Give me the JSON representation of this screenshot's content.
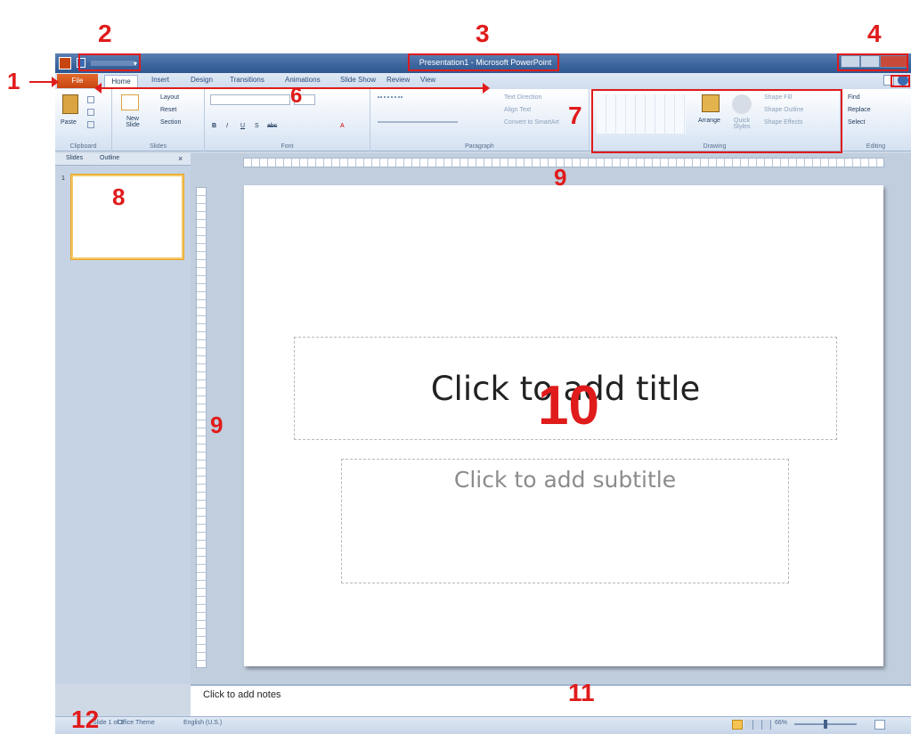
{
  "window": {
    "title": "Presentation1 - Microsoft PowerPoint"
  },
  "ribbon": {
    "tabs": [
      "File",
      "Home",
      "Insert",
      "Design",
      "Transitions",
      "Animations",
      "Slide Show",
      "Review",
      "View"
    ],
    "clipboard": {
      "paste": "Paste",
      "label": "Clipboard"
    },
    "slides": {
      "new_slide": "New Slide",
      "layout": "Layout",
      "reset": "Reset",
      "section": "Section",
      "label": "Slides"
    },
    "font": {
      "label": "Font"
    },
    "paragraph": {
      "text_direction": "Text Direction",
      "align_text": "Align Text",
      "smartart": "Convert to SmartArt",
      "label": "Paragraph"
    },
    "drawing": {
      "arrange": "Arrange",
      "quick_styles": "Quick Styles",
      "shape_fill": "Shape Fill",
      "shape_outline": "Shape Outline",
      "shape_effects": "Shape Effects",
      "label": "Drawing"
    },
    "editing": {
      "find": "Find",
      "replace": "Replace",
      "select": "Select",
      "label": "Editing"
    }
  },
  "left_panel": {
    "tabs": [
      "Slides",
      "Outline"
    ],
    "slide_number": "1"
  },
  "slide": {
    "title_placeholder": "Click to add title",
    "subtitle_placeholder": "Click to add subtitle"
  },
  "notes": {
    "placeholder": "Click to add notes"
  },
  "status_bar": {
    "slide_info": "Slide 1 of 1",
    "theme": "Office Theme",
    "language": "English (U.S.)",
    "zoom": "66%"
  },
  "annotations": [
    "1",
    "2",
    "3",
    "4",
    "6",
    "7",
    "8",
    "9",
    "9",
    "10",
    "11",
    "12"
  ],
  "colors": {
    "annotation": "#e01b1b",
    "file_tab": "#c74510",
    "title_bar": "#3c659d"
  }
}
